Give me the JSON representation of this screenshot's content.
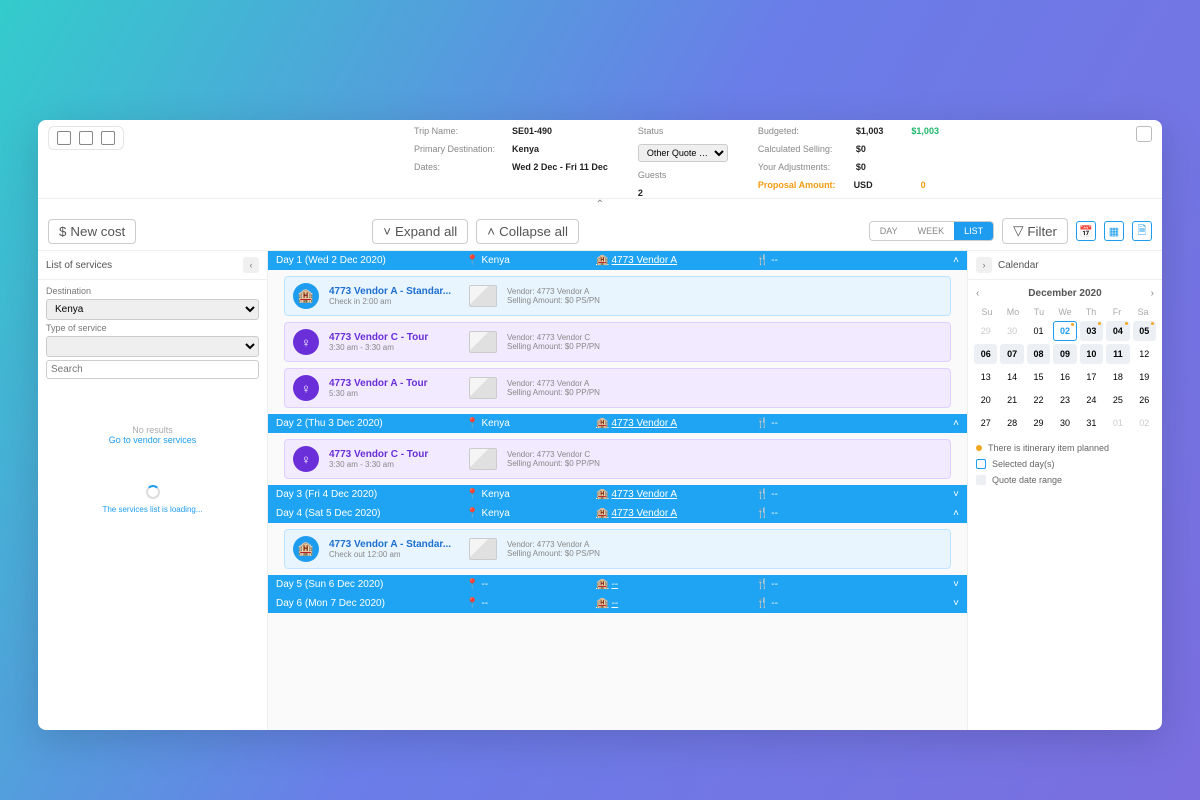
{
  "header": {
    "trip_name_label": "Trip Name:",
    "trip_name": "SE01-490",
    "primary_dest_label": "Primary Destination:",
    "primary_dest": "Kenya",
    "dates_label": "Dates:",
    "dates": "Wed 2 Dec - Fri 11 Dec",
    "status_label": "Status",
    "status_value": "Other Quote …",
    "guests_label": "Guests",
    "guests": "2",
    "budgeted_label": "Budgeted:",
    "budgeted": "$1,003",
    "budgeted2": "$1,003",
    "calc_selling_label": "Calculated Selling:",
    "calc_selling": "$0",
    "adjustments_label": "Your Adjustments:",
    "adjustments": "$0",
    "proposal_label": "Proposal Amount:",
    "proposal_currency": "USD",
    "proposal_value": "0"
  },
  "toolbar": {
    "new_cost": "New cost",
    "expand_all": "Expand all",
    "collapse_all": "Collapse all",
    "day": "DAY",
    "week": "WEEK",
    "list": "LIST",
    "filter": "Filter"
  },
  "left": {
    "title": "List of services",
    "dest_label": "Destination",
    "dest_value": "Kenya",
    "type_label": "Type of service",
    "search_placeholder": "Search",
    "no_results": "No results",
    "go_vendor": "Go to vendor services",
    "loading": "The services list is loading..."
  },
  "days": [
    {
      "title": "Day 1 (Wed 2 Dec 2020)",
      "loc": "Kenya",
      "vendor": "4773 Vendor A",
      "food": "--",
      "open": true,
      "items": [
        {
          "style": "blue",
          "icon": "bed",
          "title": "4773 Vendor A - Standar...",
          "sub": "Check in 2:00 am",
          "vendor": "4773 Vendor A",
          "selling": "$0 PS/PN"
        },
        {
          "style": "purple",
          "icon": "tour",
          "title": "4773 Vendor C - Tour",
          "sub": "3:30 am - 3:30 am",
          "vendor": "4773 Vendor C",
          "selling": "$0 PP/PN"
        },
        {
          "style": "purple",
          "icon": "tour",
          "title": "4773 Vendor A - Tour",
          "sub": "5:30 am",
          "vendor": "4773 Vendor A",
          "selling": "$0 PP/PN"
        }
      ]
    },
    {
      "title": "Day 2 (Thu 3 Dec 2020)",
      "loc": "Kenya",
      "vendor": "4773 Vendor A",
      "food": "--",
      "open": true,
      "items": [
        {
          "style": "purple",
          "icon": "tour",
          "title": "4773 Vendor C - Tour",
          "sub": "3:30 am - 3:30 am",
          "vendor": "4773 Vendor C",
          "selling": "$0 PP/PN"
        }
      ]
    },
    {
      "title": "Day 3 (Fri 4 Dec 2020)",
      "loc": "Kenya",
      "vendor": "4773 Vendor A",
      "food": "--",
      "open": false,
      "items": []
    },
    {
      "title": "Day 4 (Sat 5 Dec 2020)",
      "loc": "Kenya",
      "vendor": "4773 Vendor A",
      "food": "--",
      "open": true,
      "items": [
        {
          "style": "blue",
          "icon": "bed",
          "title": "4773 Vendor A - Standar...",
          "sub": "Check out 12:00 am",
          "vendor": "4773 Vendor A",
          "selling": "$0 PS/PN"
        }
      ]
    },
    {
      "title": "Day 5 (Sun 6 Dec 2020)",
      "loc": "--",
      "vendor": "--",
      "food": "--",
      "open": false,
      "items": []
    },
    {
      "title": "Day 6 (Mon 7 Dec 2020)",
      "loc": "--",
      "vendor": "--",
      "food": "--",
      "open": false,
      "items": []
    }
  ],
  "labels": {
    "vendor": "Vendor:",
    "selling": "Selling Amount:"
  },
  "calendar": {
    "title": "Calendar",
    "month": "December 2020",
    "dow": [
      "Su",
      "Mo",
      "Tu",
      "We",
      "Th",
      "Fr",
      "Sa"
    ],
    "cells": [
      {
        "d": "29",
        "oom": true
      },
      {
        "d": "30",
        "oom": true
      },
      {
        "d": "01"
      },
      {
        "d": "02",
        "sel": true,
        "dot": true
      },
      {
        "d": "03",
        "range": true,
        "dot": true
      },
      {
        "d": "04",
        "range": true,
        "dot": true
      },
      {
        "d": "05",
        "range": true,
        "dot": true
      },
      {
        "d": "06",
        "range": true
      },
      {
        "d": "07",
        "range": true
      },
      {
        "d": "08",
        "range": true
      },
      {
        "d": "09",
        "range": true
      },
      {
        "d": "10",
        "range": true
      },
      {
        "d": "11",
        "range": true
      },
      {
        "d": "12"
      },
      {
        "d": "13"
      },
      {
        "d": "14"
      },
      {
        "d": "15"
      },
      {
        "d": "16"
      },
      {
        "d": "17"
      },
      {
        "d": "18"
      },
      {
        "d": "19"
      },
      {
        "d": "20"
      },
      {
        "d": "21"
      },
      {
        "d": "22"
      },
      {
        "d": "23"
      },
      {
        "d": "24"
      },
      {
        "d": "25"
      },
      {
        "d": "26"
      },
      {
        "d": "27"
      },
      {
        "d": "28"
      },
      {
        "d": "29"
      },
      {
        "d": "30"
      },
      {
        "d": "31"
      },
      {
        "d": "01",
        "oom": true
      },
      {
        "d": "02",
        "oom": true
      }
    ],
    "leg1": "There is itinerary item planned",
    "leg2": "Selected day(s)",
    "leg3": "Quote date range"
  }
}
